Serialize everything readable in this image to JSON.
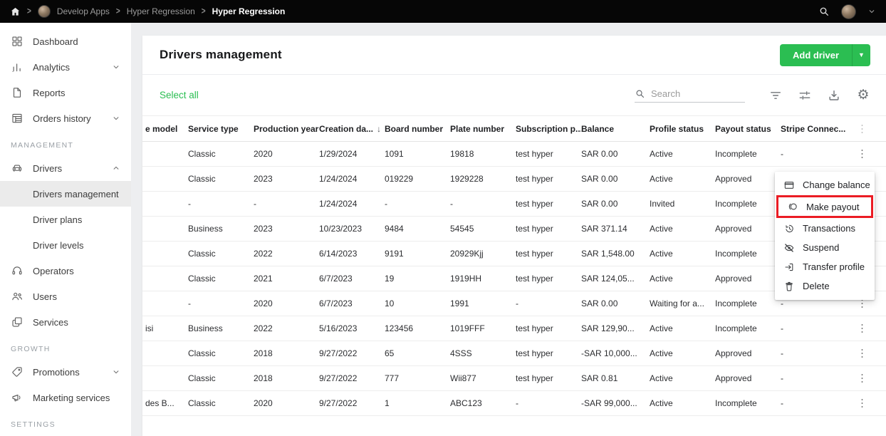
{
  "topbar": {
    "breadcrumb": [
      "Develop Apps",
      "Hyper Regression",
      "Hyper Regression"
    ]
  },
  "sidebar": {
    "entries": [
      {
        "type": "item",
        "icon": "dashboard-icon",
        "label": "Dashboard"
      },
      {
        "type": "item",
        "icon": "analytics-icon",
        "label": "Analytics",
        "chevron": "down"
      },
      {
        "type": "item",
        "icon": "reports-icon",
        "label": "Reports"
      },
      {
        "type": "item",
        "icon": "orders-history-icon",
        "label": "Orders history",
        "chevron": "down"
      },
      {
        "type": "section",
        "label": "MANAGEMENT"
      },
      {
        "type": "item",
        "icon": "drivers-icon",
        "label": "Drivers",
        "chevron": "up"
      },
      {
        "type": "subitem",
        "label": "Drivers management",
        "active": true
      },
      {
        "type": "subitem",
        "label": "Driver plans"
      },
      {
        "type": "subitem",
        "label": "Driver levels"
      },
      {
        "type": "item",
        "icon": "operators-icon",
        "label": "Operators"
      },
      {
        "type": "item",
        "icon": "users-icon",
        "label": "Users"
      },
      {
        "type": "item",
        "icon": "services-icon",
        "label": "Services"
      },
      {
        "type": "section",
        "label": "GROWTH"
      },
      {
        "type": "item",
        "icon": "promotions-icon",
        "label": "Promotions",
        "chevron": "down"
      },
      {
        "type": "item",
        "icon": "marketing-icon",
        "label": "Marketing services"
      },
      {
        "type": "section",
        "label": "SETTINGS"
      }
    ]
  },
  "main": {
    "title": "Drivers management"
  },
  "toolbar": {
    "select_all_label": "Select all",
    "search_placeholder": "Search",
    "add_driver_label": "Add driver"
  },
  "table": {
    "columns": [
      {
        "label": "e model"
      },
      {
        "label": "Service type"
      },
      {
        "label": "Production year"
      },
      {
        "label": "Creation da...",
        "sorted": true
      },
      {
        "label": "Board number"
      },
      {
        "label": "Plate number"
      },
      {
        "label": "Subscription p..."
      },
      {
        "label": "Balance"
      },
      {
        "label": "Profile status"
      },
      {
        "label": "Payout status"
      },
      {
        "label": "Stripe Connec..."
      }
    ],
    "rows": [
      {
        "cells": [
          "",
          "Classic",
          "2020",
          "1/29/2024",
          "1091",
          "19818",
          "test hyper",
          "SAR 0.00",
          "Active",
          "Incomplete",
          "-"
        ]
      },
      {
        "cells": [
          "",
          "Classic",
          "2023",
          "1/24/2024",
          "019229",
          "1929228",
          "test hyper",
          "SAR 0.00",
          "Active",
          "Approved",
          ""
        ]
      },
      {
        "cells": [
          "",
          "-",
          "-",
          "1/24/2024",
          "-",
          "-",
          "test hyper",
          "SAR 0.00",
          "Invited",
          "Incomplete",
          ""
        ]
      },
      {
        "cells": [
          "",
          "Business",
          "2023",
          "10/23/2023",
          "9484",
          "54545",
          "test hyper",
          "SAR 371.14",
          "Active",
          "Approved",
          ""
        ]
      },
      {
        "cells": [
          "",
          "Classic",
          "2022",
          "6/14/2023",
          "9191",
          "20929Kjj",
          "test hyper",
          "SAR 1,548.00",
          "Active",
          "Incomplete",
          ""
        ]
      },
      {
        "cells": [
          "",
          "Classic",
          "2021",
          "6/7/2023",
          "19",
          "1919HH",
          "test hyper",
          "SAR 124,05...",
          "Active",
          "Approved",
          ""
        ]
      },
      {
        "cells": [
          "",
          "-",
          "2020",
          "6/7/2023",
          "10",
          "1991",
          "-",
          "SAR 0.00",
          "Waiting for a...",
          "Incomplete",
          "-"
        ]
      },
      {
        "cells": [
          "isi",
          "Business",
          "2022",
          "5/16/2023",
          "123456",
          "1019FFF",
          "test hyper",
          "SAR 129,90...",
          "Active",
          "Incomplete",
          "-"
        ]
      },
      {
        "cells": [
          "",
          "Classic",
          "2018",
          "9/27/2022",
          "65",
          "4SSS",
          "test hyper",
          "-SAR 10,000...",
          "Active",
          "Approved",
          "-"
        ]
      },
      {
        "cells": [
          "",
          "Classic",
          "2018",
          "9/27/2022",
          "777",
          "Wii877",
          "test hyper",
          "SAR 0.81",
          "Active",
          "Approved",
          "-"
        ]
      },
      {
        "cells": [
          "des B...",
          "Classic",
          "2020",
          "9/27/2022",
          "1",
          "ABC123",
          "-",
          "-SAR 99,000...",
          "Active",
          "Incomplete",
          "-"
        ]
      }
    ]
  },
  "menu": {
    "items": [
      {
        "icon": "card-icon",
        "label": "Change balance"
      },
      {
        "icon": "payout-icon",
        "label": "Make payout",
        "highlighted": true
      },
      {
        "icon": "history-icon",
        "label": "Transactions"
      },
      {
        "icon": "eye-off-icon",
        "label": "Suspend"
      },
      {
        "icon": "transfer-icon",
        "label": "Transfer profile"
      },
      {
        "icon": "delete-icon",
        "label": "Delete"
      }
    ]
  },
  "colors": {
    "accent_green": "#2BBE52",
    "highlight_red": "#EB1C24"
  }
}
